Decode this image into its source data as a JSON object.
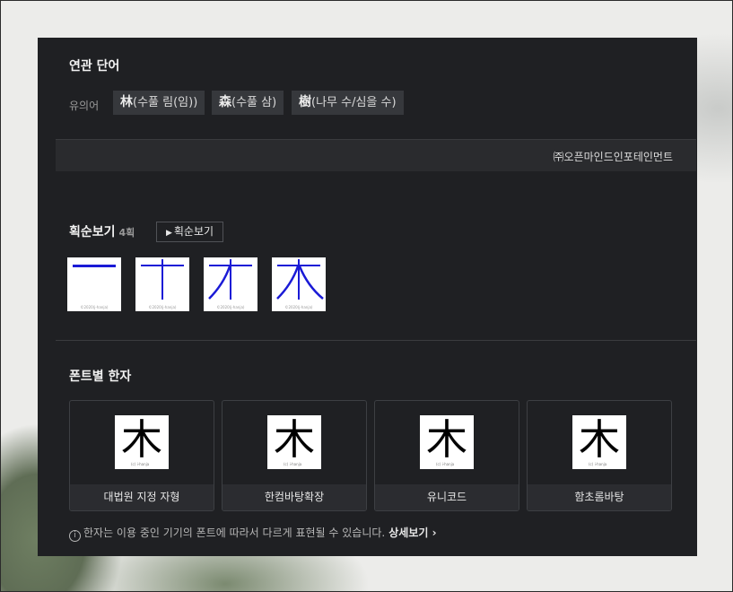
{
  "related": {
    "title": "연관 단어",
    "synonym_label": "유의어",
    "chips": [
      {
        "hanja": "林",
        "reading": "(수풀 림(임))"
      },
      {
        "hanja": "森",
        "reading": "(수풀 삼)"
      },
      {
        "hanja": "樹",
        "reading": "(나무 수/심을 수)"
      }
    ],
    "publisher": "㈜오픈마인드인포테인먼트"
  },
  "stroke_order": {
    "title": "획순보기",
    "count": "4획",
    "button_label": "획순보기",
    "frames": [
      "一",
      "十",
      "オ",
      "木"
    ],
    "copyright": "©2020(j-hanja)"
  },
  "fonts": {
    "title": "폰트별 한자",
    "glyph": "木",
    "watermark": "(c) i-hanja",
    "cards": [
      {
        "label": "대법원 지정 자형"
      },
      {
        "label": "한컴바탕확장"
      },
      {
        "label": "유니코드"
      },
      {
        "label": "함초롬바탕"
      }
    ],
    "note": "한자는 이용 중인 기기의 폰트에 따라서 다르게 표현될 수 있습니다.",
    "note_link": "상세보기",
    "info_icon": "info-circle-icon"
  },
  "colors": {
    "panel_bg": "#1f2023",
    "chip_bg": "#36383c",
    "stroke_blue": "#1a1ad6"
  }
}
